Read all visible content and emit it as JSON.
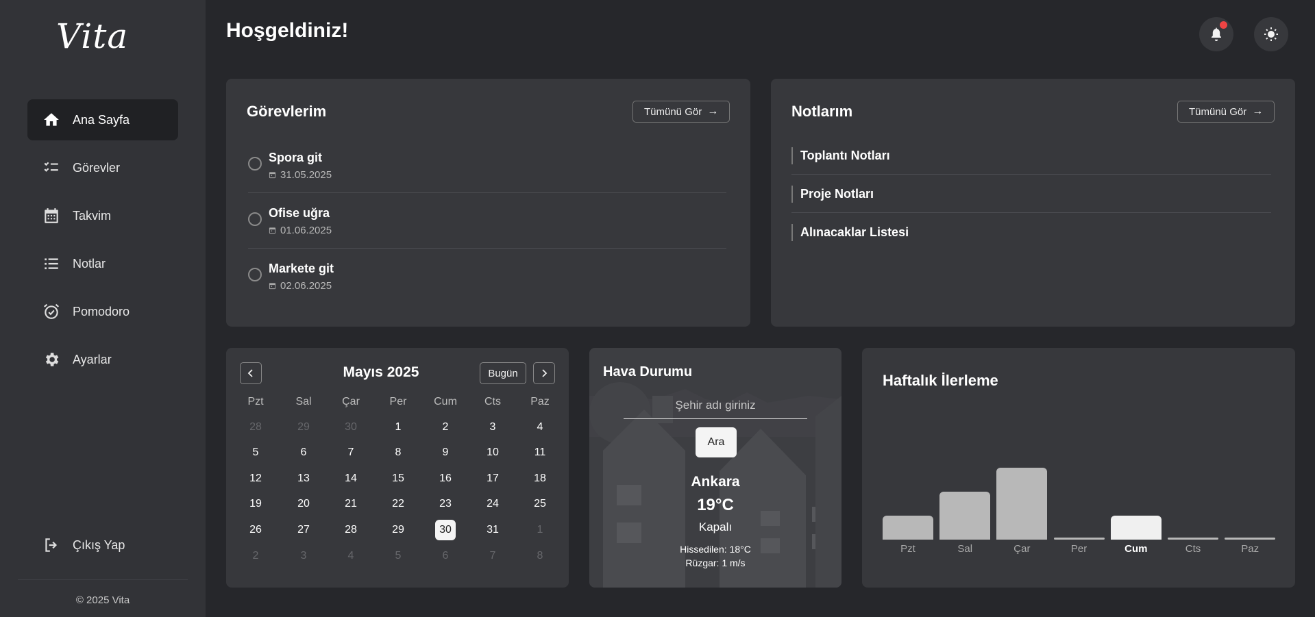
{
  "app": {
    "logo": "Vita",
    "copyright": "© 2025 Vita"
  },
  "sidebar": {
    "items": [
      {
        "label": "Ana Sayfa",
        "icon": "home-icon",
        "active": true
      },
      {
        "label": "Görevler",
        "icon": "checklist-icon"
      },
      {
        "label": "Takvim",
        "icon": "calendar-icon"
      },
      {
        "label": "Notlar",
        "icon": "list-icon"
      },
      {
        "label": "Pomodoro",
        "icon": "alarm-icon"
      },
      {
        "label": "Ayarlar",
        "icon": "gear-icon"
      }
    ],
    "logout_label": "Çıkış Yap"
  },
  "header": {
    "title": "Hoşgeldiniz!",
    "notification_dot": true
  },
  "tasks": {
    "title": "Görevlerim",
    "see_all": "Tümünü Gör",
    "items": [
      {
        "title": "Spora git",
        "date": "31.05.2025"
      },
      {
        "title": "Ofise uğra",
        "date": "01.06.2025"
      },
      {
        "title": "Markete git",
        "date": "02.06.2025"
      }
    ]
  },
  "notes": {
    "title": "Notlarım",
    "see_all": "Tümünü Gör",
    "items": [
      "Toplantı Notları",
      "Proje Notları",
      "Alınacaklar Listesi"
    ]
  },
  "calendar": {
    "month_title": "Mayıs 2025",
    "today_label": "Bugün",
    "weekdays": [
      "Pzt",
      "Sal",
      "Çar",
      "Per",
      "Cum",
      "Cts",
      "Paz"
    ],
    "weeks": [
      [
        "28",
        "29",
        "30",
        "1",
        "2",
        "3",
        "4"
      ],
      [
        "5",
        "6",
        "7",
        "8",
        "9",
        "10",
        "11"
      ],
      [
        "12",
        "13",
        "14",
        "15",
        "16",
        "17",
        "18"
      ],
      [
        "19",
        "20",
        "21",
        "22",
        "23",
        "24",
        "25"
      ],
      [
        "26",
        "27",
        "28",
        "29",
        "30",
        "31",
        "1"
      ],
      [
        "2",
        "3",
        "4",
        "5",
        "6",
        "7",
        "8"
      ]
    ],
    "today": "30"
  },
  "weather": {
    "title": "Hava Durumu",
    "input_placeholder": "Şehir adı giriniz",
    "search_label": "Ara",
    "city": "Ankara",
    "temperature": "19°C",
    "condition": "Kapalı",
    "feels_like": "Hissedilen: 18°C",
    "wind": "Rüzgar: 1 m/s"
  },
  "weekly": {
    "title": "Haftalık İlerleme",
    "active_day": "Cum",
    "chart_data": {
      "type": "bar",
      "categories": [
        "Pzt",
        "Sal",
        "Çar",
        "Per",
        "Cum",
        "Cts",
        "Paz"
      ],
      "values": [
        1,
        2,
        3,
        0,
        1,
        0,
        0
      ],
      "ylim": [
        0,
        3
      ],
      "grid": false,
      "colors": {
        "default": "#b8b8b8",
        "active": "#f0f0f0"
      }
    }
  }
}
